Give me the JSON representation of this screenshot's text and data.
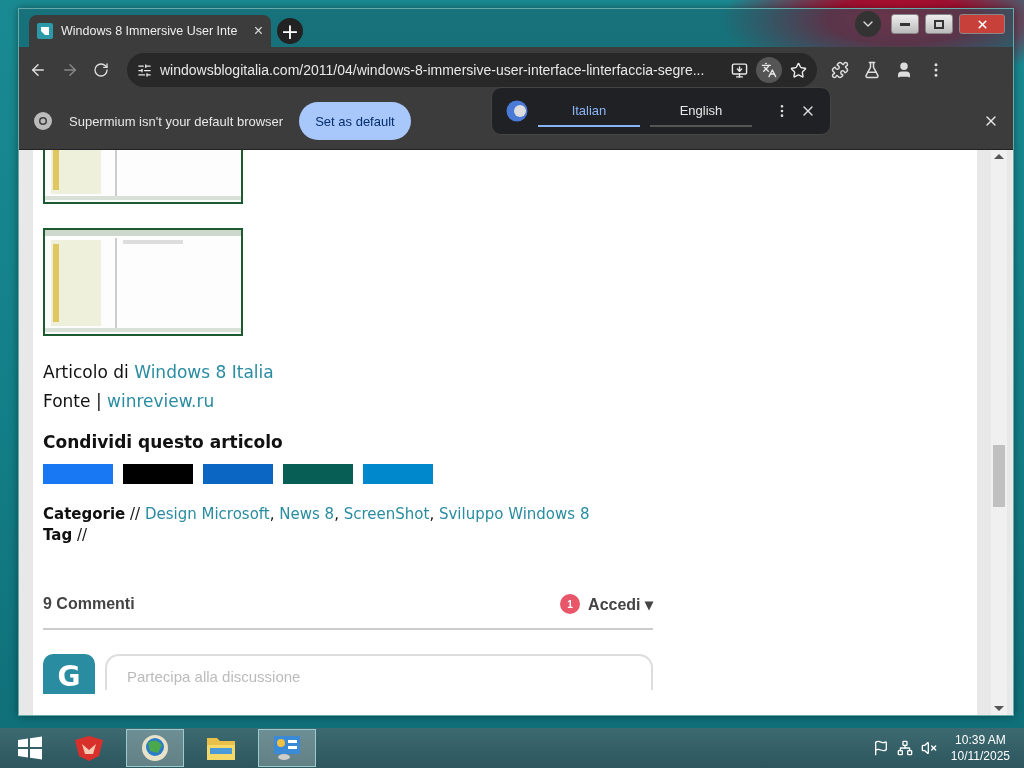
{
  "browser": {
    "tab": {
      "title": "Windows 8 Immersive User Inte",
      "close": "×"
    },
    "new_tab": "+",
    "address": "windowsblogitalia.com/2011/04/windows-8-immersive-user-interface-linterfaccia-segre...",
    "infobar": {
      "message": "Supermium isn't your default browser",
      "button": "Set as default"
    },
    "translate": {
      "tabs": [
        {
          "label": "Italian",
          "selected": true
        },
        {
          "label": "English",
          "selected": false
        }
      ]
    }
  },
  "article": {
    "images": [
      {
        "kind": "picture"
      },
      {
        "kind": "picture"
      }
    ],
    "credits": [
      {
        "label": "Articolo di",
        "link": "Windows 8 Italia"
      },
      {
        "label": "Fonte |",
        "link": "winreview.ru"
      }
    ],
    "share_title": "Condividi questo articolo",
    "share_buttons": [
      {
        "color": "#1877f2"
      },
      {
        "color": "#000000"
      },
      {
        "color": "#0a66c2"
      },
      {
        "color": "#075e54"
      },
      {
        "color": "#0088cc"
      }
    ],
    "categories_label": "Categorie",
    "categories_sep": "//",
    "categories_join": ",",
    "categories": [
      "Design Microsoft",
      "News 8",
      "ScreenShot",
      "Sviluppo Windows 8"
    ],
    "tag_label": "Tag",
    "tag_sep": "//"
  },
  "comments": {
    "count": "9 Commenti",
    "badge": "1",
    "login": "Accedi ▾",
    "avatar": "G",
    "placeholder": "Partecipa alla discussione"
  },
  "taskbar": {
    "apps": [
      {
        "kind": "store",
        "selected": false
      },
      {
        "kind": "browser",
        "selected": true
      },
      {
        "kind": "folder",
        "selected": false
      },
      {
        "kind": "control",
        "selected": true
      }
    ],
    "time": "10:39 AM",
    "date": "10/11/2025"
  }
}
